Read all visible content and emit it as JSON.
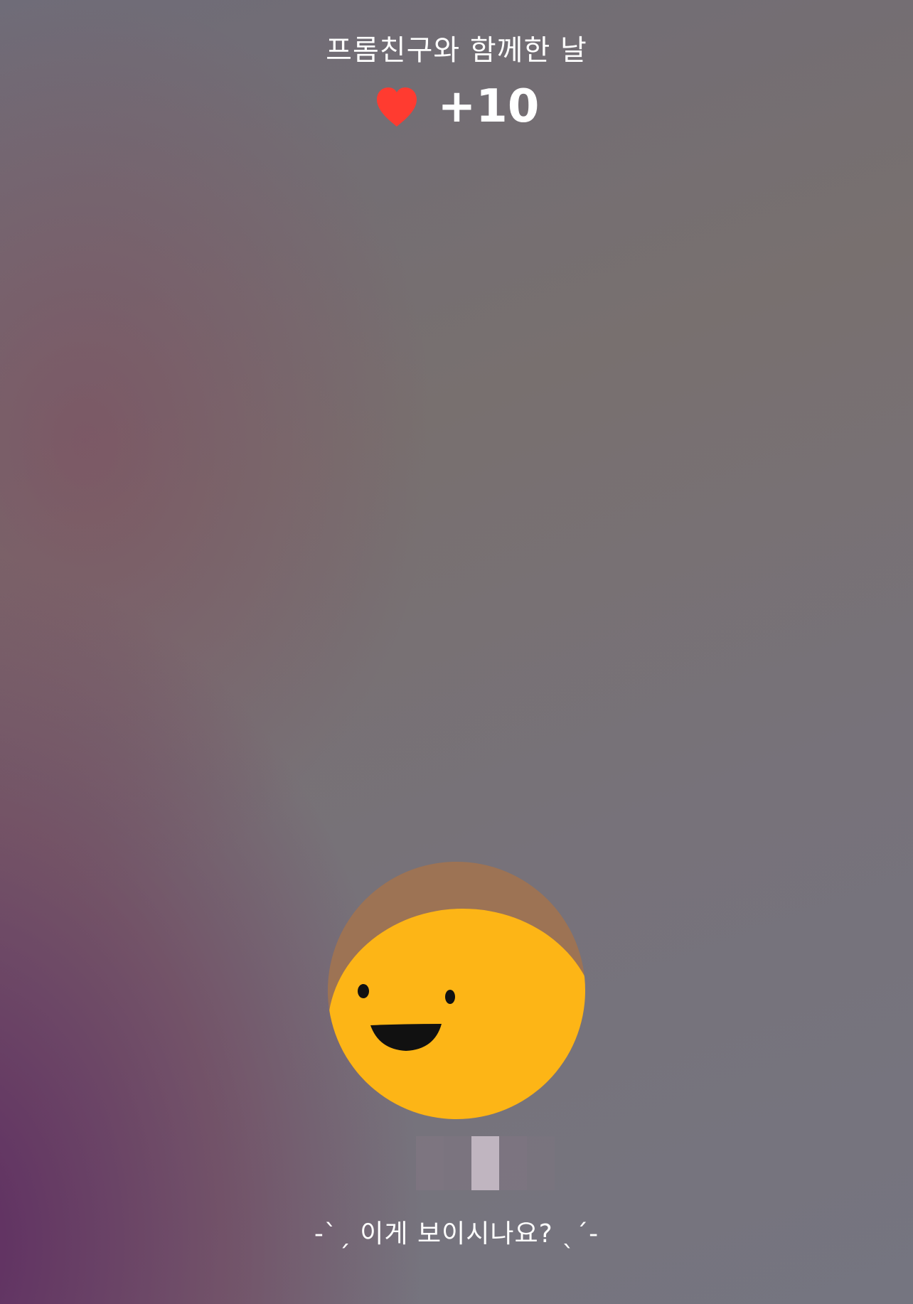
{
  "screen": {
    "title": "프롬친구와 함께한 날",
    "reward": {
      "icon": "heart-icon",
      "value": "+10",
      "heart_color": "#ff3b30"
    },
    "avatar": {
      "icon": "smiley-face-icon",
      "face_color": "#fdb516",
      "background_color": "#9d7354"
    },
    "caption": "-ˋˏ 이게 보이시나요? ˎˊ-"
  }
}
